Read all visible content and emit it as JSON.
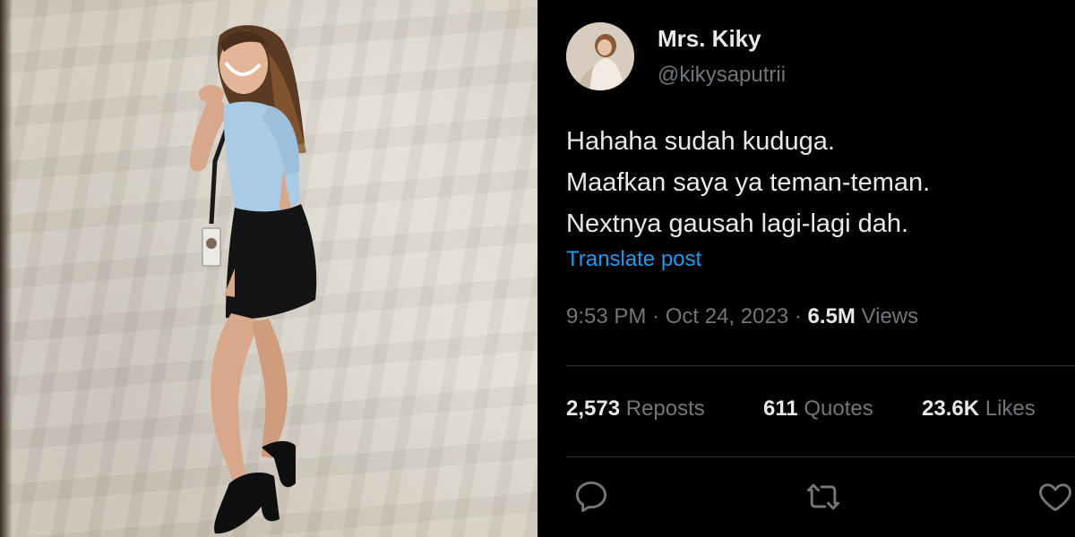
{
  "photo": {
    "icon": "woman-portrait-photo",
    "shirt_color": "#a9cbe6",
    "skirt_color": "#121416",
    "backdrop_color": "#d9d3c8"
  },
  "tweet": {
    "display_name": "Mrs. Kiky",
    "handle": "@kikysaputrii",
    "text_lines": [
      "Hahaha sudah kuduga.",
      "Maafkan saya ya teman-teman.",
      "Nextnya gausah lagi-lagi dah."
    ],
    "translate_label": "Translate post",
    "time": "9:53 PM",
    "separator": "·",
    "date": "Oct 24, 2023",
    "views_count": "6.5M",
    "views_label": "Views",
    "stats": {
      "reposts_count": "2,573",
      "reposts_label": "Reposts",
      "quotes_count": "611",
      "quotes_label": "Quotes",
      "likes_count": "23.6K",
      "likes_label": "Likes"
    },
    "actions": {
      "reply_icon": "reply-icon",
      "repost_icon": "repost-icon",
      "like_icon": "heart-icon"
    },
    "colors": {
      "background": "#000000",
      "primary_text": "#e7e9ea",
      "secondary_text": "#71767b",
      "link": "#1d9bf0",
      "divider": "#2f3336"
    }
  }
}
